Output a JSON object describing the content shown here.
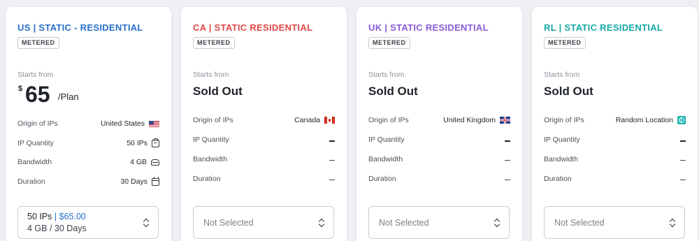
{
  "common": {
    "badge": "METERED",
    "starts_from": "Starts from",
    "labels": {
      "origin": "Origin of IPs",
      "quantity": "IP Quantity",
      "bandwidth": "Bandwidth",
      "duration": "Duration"
    },
    "placeholder": "Not Selected"
  },
  "cards": [
    {
      "title": "US | STATIC - RESIDENTIAL",
      "title_color": "#2a6fc9",
      "currency": "$",
      "price": "65",
      "price_unit": "/Plan",
      "origin": "United States",
      "origin_icon": "us-flag-icon",
      "quantity": "50 IPs",
      "bandwidth": "4 GB",
      "duration": "30 Days",
      "selected": {
        "line1_qty": "50 IPs",
        "separator": "|",
        "line1_price": "$65.00",
        "line2": "4 GB / 30 Days"
      }
    },
    {
      "title": "CA | STATIC RESIDENTIAL",
      "title_color": "#e04848",
      "status": "Sold Out",
      "origin": "Canada",
      "origin_icon": "ca-flag-icon"
    },
    {
      "title": "UK | STATIC RESIDENTIAL",
      "title_color": "#8a5bd6",
      "status": "Sold Out",
      "origin": "United Kingdom",
      "origin_icon": "uk-flag-icon"
    },
    {
      "title": "RL | STATIC RESIDENTIAL",
      "title_color": "#17a9a4",
      "status": "Sold Out",
      "origin": "Random Location",
      "origin_icon": "globe-icon"
    }
  ]
}
